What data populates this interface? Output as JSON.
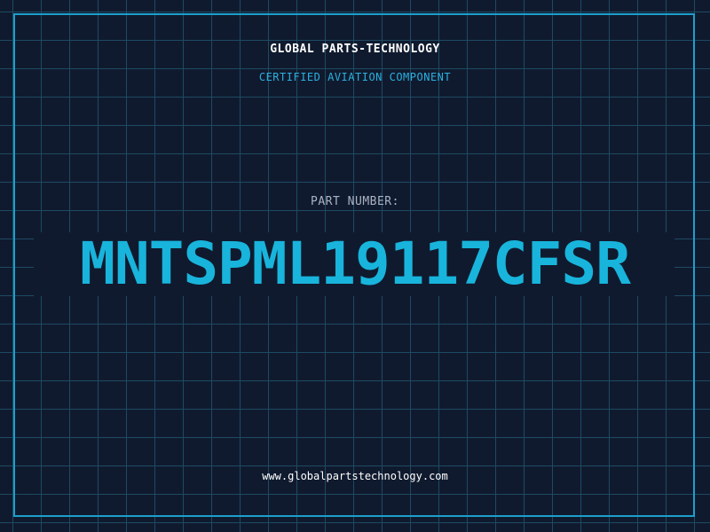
{
  "header": {
    "company": "GLOBAL PARTS-TECHNOLOGY",
    "subtitle": "CERTIFIED AVIATION COMPONENT"
  },
  "part": {
    "label": "PART NUMBER:",
    "number": "MNTSPML19117CFSR"
  },
  "footer": {
    "website": "www.globalpartstechnology.com"
  },
  "colors": {
    "background": "#101a2e",
    "grid": "#1d4a63",
    "frame": "#1c9fcc",
    "accent": "#18b4dc"
  }
}
